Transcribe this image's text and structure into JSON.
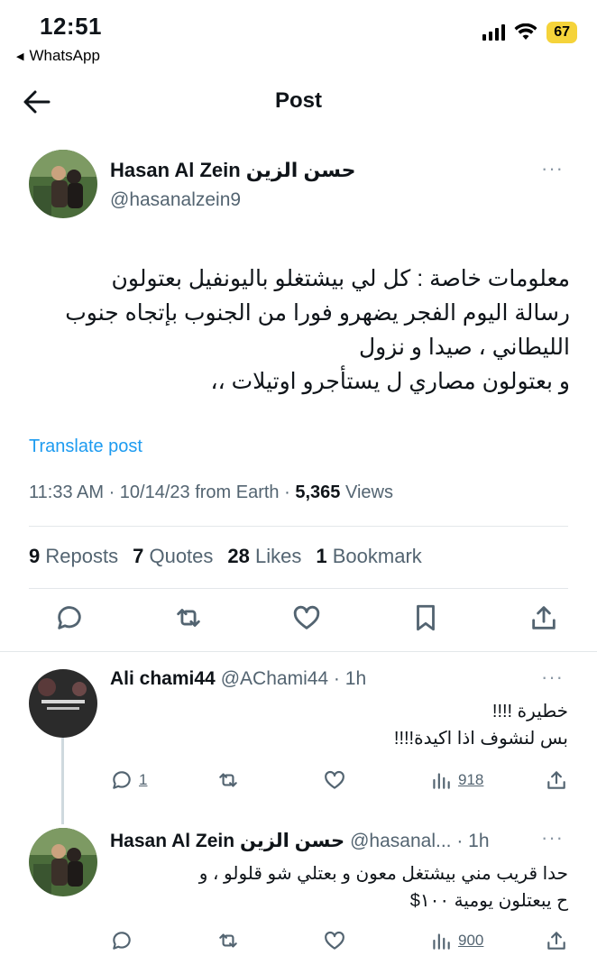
{
  "status_bar": {
    "time": "12:51",
    "back_app": "WhatsApp",
    "battery": "67"
  },
  "nav": {
    "title": "Post"
  },
  "post": {
    "author_name": "Hasan Al Zein حسن الزين",
    "author_handle": "@hasanalzein9",
    "text": "معلومات خاصة : كل لي بيشتغلو باليونفيل بعتولون\nرسالة اليوم الفجر يضهرو فورا من الجنوب بإتجاه جنوب\nالليطاني ، صيدا و نزول\nو بعتولون مصاري ل يستأجرو اوتيلات ،،",
    "translate_label": "Translate post",
    "timestamp": "11:33 AM · 10/14/23 from Earth · ",
    "views_count": "5,365",
    "views_label": " Views",
    "stats": {
      "reposts_count": "9",
      "reposts_label": "Reposts",
      "quotes_count": "7",
      "quotes_label": "Quotes",
      "likes_count": "28",
      "likes_label": "Likes",
      "bookmarks_count": "1",
      "bookmarks_label": "Bookmark"
    }
  },
  "replies": [
    {
      "author_name": "Ali chami44",
      "author_handle": "@AChami44 · 1h",
      "text": "خطيرة !!!!\nبس لنشوف اذا اكيدة!!!!",
      "reply_count": "1",
      "views": "918"
    },
    {
      "author_name": "Hasan Al Zein حسن الزين",
      "author_handle": "@hasanal... · 1h",
      "text": "حدا قريب مني بيشتغل معون و بعتلي شو قلولو ، و\nح يبعتلون يومية ١٠٠$",
      "reply_count": "",
      "views": "900"
    }
  ],
  "colors": {
    "accent": "#1d9bf0",
    "muted": "#536471",
    "battery": "#f5d33a"
  }
}
